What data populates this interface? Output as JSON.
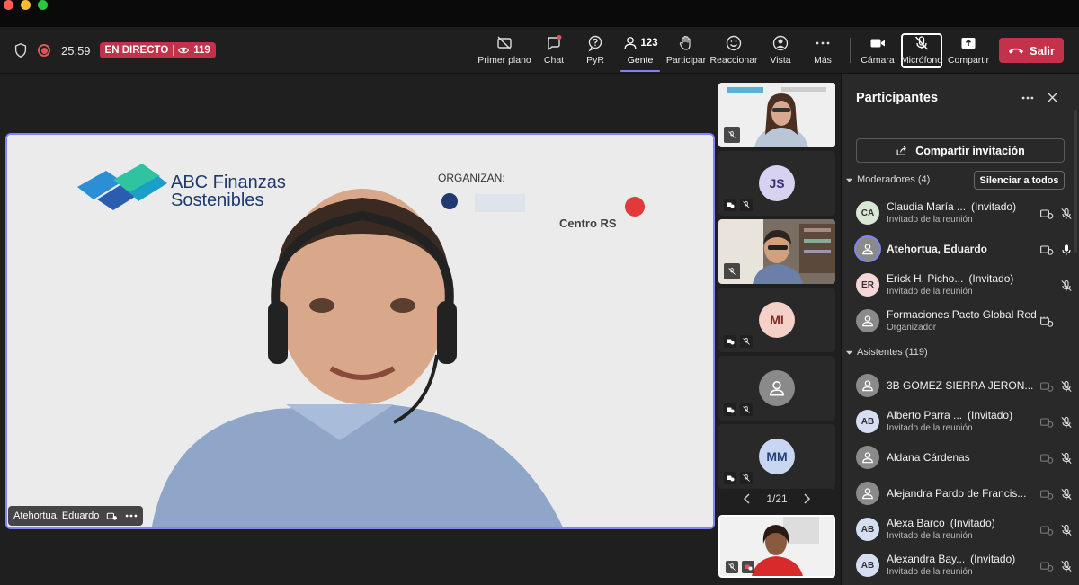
{
  "toolbar": {
    "timer": "25:59",
    "live_label": "EN DIRECTO",
    "viewer_count": "119",
    "buttons": {
      "primer_plano": "Primer plano",
      "chat": "Chat",
      "pyr": "PyR",
      "gente": "Gente",
      "gente_count": "123",
      "participar": "Participar",
      "reaccionar": "Reaccionar",
      "vista": "Vista",
      "mas": "Más",
      "camara": "Cámara",
      "microfono": "Micrófono",
      "compartir": "Compartir"
    },
    "leave_label": "Salir"
  },
  "stage": {
    "main_name": "Atehortua, Eduardo",
    "slide_brand_line1": "ABC Finanzas",
    "slide_brand_line2": "Sostenibles",
    "slide_organizan": "ORGANIZAN:",
    "slide_centro": "Centro RS",
    "thumbnails": [
      {
        "initials": "",
        "kind": "video-woman"
      },
      {
        "initials": "JS",
        "kind": "avatar"
      },
      {
        "initials": "",
        "kind": "video-man"
      },
      {
        "initials": "MI",
        "kind": "avatar"
      },
      {
        "initials": "",
        "kind": "generic"
      },
      {
        "initials": "MM",
        "kind": "avatar"
      }
    ],
    "pager": "1/21"
  },
  "panel": {
    "title": "Participantes",
    "share_label": "Compartir invitación",
    "moderators_header": "Moderadores (4)",
    "mute_all_label": "Silenciar a todos",
    "attendees_header": "Asistentes (119)",
    "moderators": [
      {
        "initials": "CA",
        "name": "Claudia María ...",
        "tag": "(Invitado)",
        "sub": "Invitado de la reunión"
      },
      {
        "initials": "",
        "name": "Atehortua, Eduardo",
        "tag": "",
        "sub": ""
      },
      {
        "initials": "ER",
        "name": "Erick H. Picho...",
        "tag": "(Invitado)",
        "sub": "Invitado de la reunión"
      },
      {
        "initials": "",
        "name": "Formaciones Pacto Global Red ...",
        "tag": "",
        "sub": "Organizador"
      }
    ],
    "attendees": [
      {
        "initials": "",
        "name": "3B GOMEZ SIERRA JERON...",
        "tag": "",
        "sub": ""
      },
      {
        "initials": "AB",
        "name": "Alberto Parra ...",
        "tag": "(Invitado)",
        "sub": "Invitado de la reunión"
      },
      {
        "initials": "",
        "name": "Aldana Cárdenas",
        "tag": "",
        "sub": ""
      },
      {
        "initials": "",
        "name": "Alejandra Pardo de Francis...",
        "tag": "",
        "sub": ""
      },
      {
        "initials": "AB",
        "name": "Alexa Barco",
        "tag": "(Invitado)",
        "sub": "Invitado de la reunión"
      },
      {
        "initials": "AB",
        "name": "Alexandra Bay...",
        "tag": "(Invitado)",
        "sub": "Invitado de la reunión"
      }
    ]
  },
  "colors": {
    "accent": "#7f85f5",
    "live_red": "#c4314b",
    "background": "#1f1f1f",
    "panel": "#292929"
  }
}
